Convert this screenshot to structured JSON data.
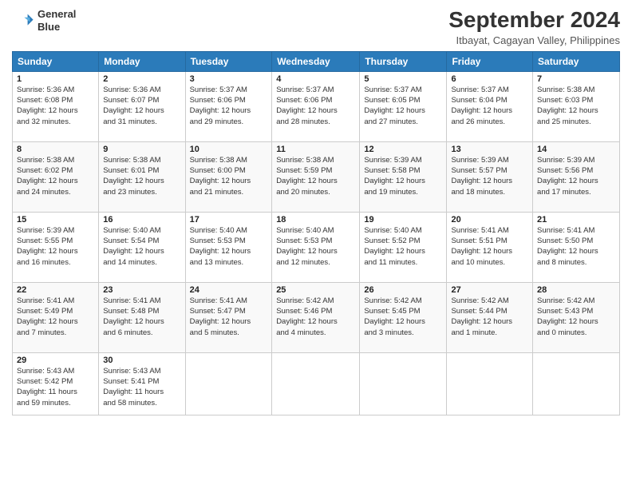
{
  "header": {
    "logo_line1": "General",
    "logo_line2": "Blue",
    "month_title": "September 2024",
    "location": "Itbayat, Cagayan Valley, Philippines"
  },
  "days_of_week": [
    "Sunday",
    "Monday",
    "Tuesday",
    "Wednesday",
    "Thursday",
    "Friday",
    "Saturday"
  ],
  "weeks": [
    [
      {
        "num": "1",
        "info": "Sunrise: 5:36 AM\nSunset: 6:08 PM\nDaylight: 12 hours\nand 32 minutes."
      },
      {
        "num": "2",
        "info": "Sunrise: 5:36 AM\nSunset: 6:07 PM\nDaylight: 12 hours\nand 31 minutes."
      },
      {
        "num": "3",
        "info": "Sunrise: 5:37 AM\nSunset: 6:06 PM\nDaylight: 12 hours\nand 29 minutes."
      },
      {
        "num": "4",
        "info": "Sunrise: 5:37 AM\nSunset: 6:06 PM\nDaylight: 12 hours\nand 28 minutes."
      },
      {
        "num": "5",
        "info": "Sunrise: 5:37 AM\nSunset: 6:05 PM\nDaylight: 12 hours\nand 27 minutes."
      },
      {
        "num": "6",
        "info": "Sunrise: 5:37 AM\nSunset: 6:04 PM\nDaylight: 12 hours\nand 26 minutes."
      },
      {
        "num": "7",
        "info": "Sunrise: 5:38 AM\nSunset: 6:03 PM\nDaylight: 12 hours\nand 25 minutes."
      }
    ],
    [
      {
        "num": "8",
        "info": "Sunrise: 5:38 AM\nSunset: 6:02 PM\nDaylight: 12 hours\nand 24 minutes."
      },
      {
        "num": "9",
        "info": "Sunrise: 5:38 AM\nSunset: 6:01 PM\nDaylight: 12 hours\nand 23 minutes."
      },
      {
        "num": "10",
        "info": "Sunrise: 5:38 AM\nSunset: 6:00 PM\nDaylight: 12 hours\nand 21 minutes."
      },
      {
        "num": "11",
        "info": "Sunrise: 5:38 AM\nSunset: 5:59 PM\nDaylight: 12 hours\nand 20 minutes."
      },
      {
        "num": "12",
        "info": "Sunrise: 5:39 AM\nSunset: 5:58 PM\nDaylight: 12 hours\nand 19 minutes."
      },
      {
        "num": "13",
        "info": "Sunrise: 5:39 AM\nSunset: 5:57 PM\nDaylight: 12 hours\nand 18 minutes."
      },
      {
        "num": "14",
        "info": "Sunrise: 5:39 AM\nSunset: 5:56 PM\nDaylight: 12 hours\nand 17 minutes."
      }
    ],
    [
      {
        "num": "15",
        "info": "Sunrise: 5:39 AM\nSunset: 5:55 PM\nDaylight: 12 hours\nand 16 minutes."
      },
      {
        "num": "16",
        "info": "Sunrise: 5:40 AM\nSunset: 5:54 PM\nDaylight: 12 hours\nand 14 minutes."
      },
      {
        "num": "17",
        "info": "Sunrise: 5:40 AM\nSunset: 5:53 PM\nDaylight: 12 hours\nand 13 minutes."
      },
      {
        "num": "18",
        "info": "Sunrise: 5:40 AM\nSunset: 5:53 PM\nDaylight: 12 hours\nand 12 minutes."
      },
      {
        "num": "19",
        "info": "Sunrise: 5:40 AM\nSunset: 5:52 PM\nDaylight: 12 hours\nand 11 minutes."
      },
      {
        "num": "20",
        "info": "Sunrise: 5:41 AM\nSunset: 5:51 PM\nDaylight: 12 hours\nand 10 minutes."
      },
      {
        "num": "21",
        "info": "Sunrise: 5:41 AM\nSunset: 5:50 PM\nDaylight: 12 hours\nand 8 minutes."
      }
    ],
    [
      {
        "num": "22",
        "info": "Sunrise: 5:41 AM\nSunset: 5:49 PM\nDaylight: 12 hours\nand 7 minutes."
      },
      {
        "num": "23",
        "info": "Sunrise: 5:41 AM\nSunset: 5:48 PM\nDaylight: 12 hours\nand 6 minutes."
      },
      {
        "num": "24",
        "info": "Sunrise: 5:41 AM\nSunset: 5:47 PM\nDaylight: 12 hours\nand 5 minutes."
      },
      {
        "num": "25",
        "info": "Sunrise: 5:42 AM\nSunset: 5:46 PM\nDaylight: 12 hours\nand 4 minutes."
      },
      {
        "num": "26",
        "info": "Sunrise: 5:42 AM\nSunset: 5:45 PM\nDaylight: 12 hours\nand 3 minutes."
      },
      {
        "num": "27",
        "info": "Sunrise: 5:42 AM\nSunset: 5:44 PM\nDaylight: 12 hours\nand 1 minute."
      },
      {
        "num": "28",
        "info": "Sunrise: 5:42 AM\nSunset: 5:43 PM\nDaylight: 12 hours\nand 0 minutes."
      }
    ],
    [
      {
        "num": "29",
        "info": "Sunrise: 5:43 AM\nSunset: 5:42 PM\nDaylight: 11 hours\nand 59 minutes."
      },
      {
        "num": "30",
        "info": "Sunrise: 5:43 AM\nSunset: 5:41 PM\nDaylight: 11 hours\nand 58 minutes."
      },
      null,
      null,
      null,
      null,
      null
    ]
  ]
}
